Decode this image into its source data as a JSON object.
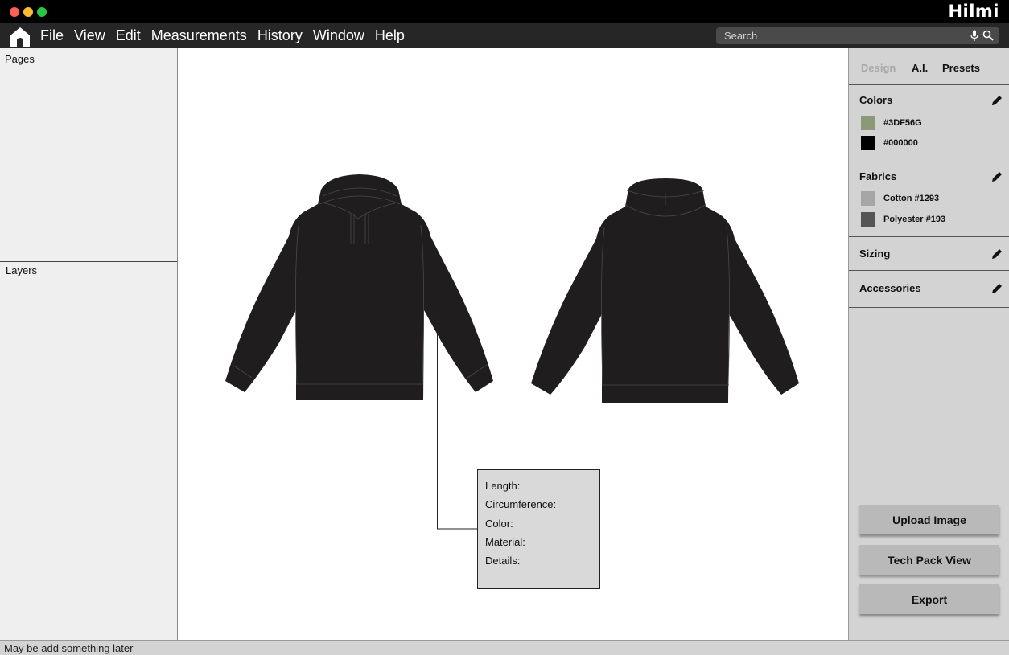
{
  "app": {
    "brand": "Hilmi"
  },
  "menu": {
    "items": [
      "File",
      "View",
      "Edit",
      "Measurements",
      "History",
      "Window",
      "Help"
    ],
    "home_icon": "home-icon"
  },
  "search": {
    "placeholder": "Search",
    "mic_icon": "microphone-icon",
    "search_icon": "magnifier-icon"
  },
  "left_panel": {
    "pages_title": "Pages",
    "layers_title": "Layers"
  },
  "canvas": {
    "garment_color": "#1f1d1e",
    "infobox": {
      "rows": [
        "Length:",
        "Circumference:",
        "Color:",
        "Material:",
        "Details:"
      ]
    }
  },
  "right_panel": {
    "tabs": [
      {
        "label": "Design",
        "active": false
      },
      {
        "label": "A.I.",
        "active": true
      },
      {
        "label": "Presets",
        "active": true
      }
    ],
    "colors": {
      "title": "Colors",
      "swatches": [
        {
          "label": "#3DF56G",
          "color": "#8a9a76"
        },
        {
          "label": "#000000",
          "color": "#000000"
        }
      ]
    },
    "fabrics": {
      "title": "Fabrics",
      "swatches": [
        {
          "label": "Cotton #1293",
          "color": "#a6a6a6"
        },
        {
          "label": "Polyester #193",
          "color": "#555555"
        }
      ]
    },
    "sizing": {
      "title": "Sizing"
    },
    "accessories": {
      "title": "Accessories"
    },
    "buttons": {
      "upload": "Upload Image",
      "techpack": "Tech Pack View",
      "export": "Export"
    }
  },
  "status": {
    "text": "May be add something later"
  }
}
